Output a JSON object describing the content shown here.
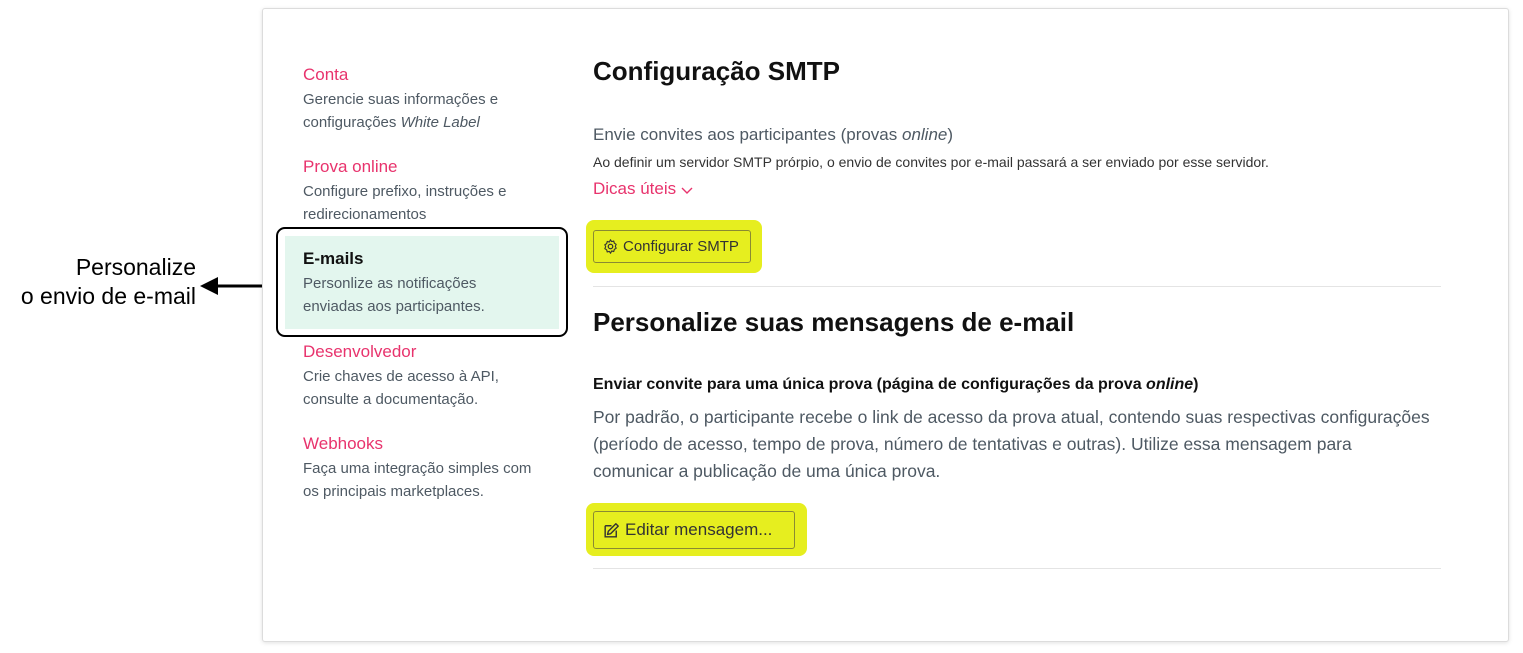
{
  "annotation": {
    "line1": "Personalize",
    "line2": "o envio de e-mail"
  },
  "nav": {
    "items": [
      {
        "title": "Conta",
        "desc_a": "Gerencie suas informações e",
        "desc_b": "configurações ",
        "desc_b_em": "White Label"
      },
      {
        "title": "Prova online",
        "desc_a": "Configure prefixo, instruções e",
        "desc_b": "redirecionamentos"
      },
      {
        "title": "E-mails",
        "desc_a": "Personlize as notificações",
        "desc_b": "enviadas aos participantes."
      },
      {
        "title": "Desenvolvedor",
        "desc_a": "Crie chaves de acesso à API,",
        "desc_b": "consulte a documentação."
      },
      {
        "title": "Webhooks",
        "desc_a": "Faça uma integração simples com",
        "desc_b": "os principais marketplaces."
      }
    ]
  },
  "smtp": {
    "heading": "Configuração SMTP",
    "lead_a": "Envie convites aos participantes (provas ",
    "lead_em": "online",
    "lead_b": ")",
    "small": "Ao definir um servidor SMTP prórpio, o envio de convites por e-mail passará a ser enviado por esse servidor.",
    "tips_link": "Dicas úteis",
    "button": "Configurar SMTP"
  },
  "messages": {
    "heading": "Personalize suas mensagens de e-mail",
    "subhead_a": "Enviar convite para uma única prova (página de configurações da prova ",
    "subhead_em": "online",
    "subhead_b": ")",
    "para_1": "Por padrão, o participante recebe o link de acesso da prova atual, contendo suas respectivas configurações",
    "para_2": "(período de acesso, tempo de prova, número de tentativas e outras). Utilize essa mensagem para",
    "para_3": "comunicar a publicação de uma única prova.",
    "button": "Editar mensagem..."
  },
  "colors": {
    "accent": "#e8336d",
    "highlight": "#e6ee1f",
    "active_nav_bg": "#e3f6ee"
  },
  "icons": {
    "smtp_button": "gear-icon",
    "edit_button": "edit-icon",
    "tips": "chevron-down-icon",
    "annotation": "arrow-left-icon"
  }
}
